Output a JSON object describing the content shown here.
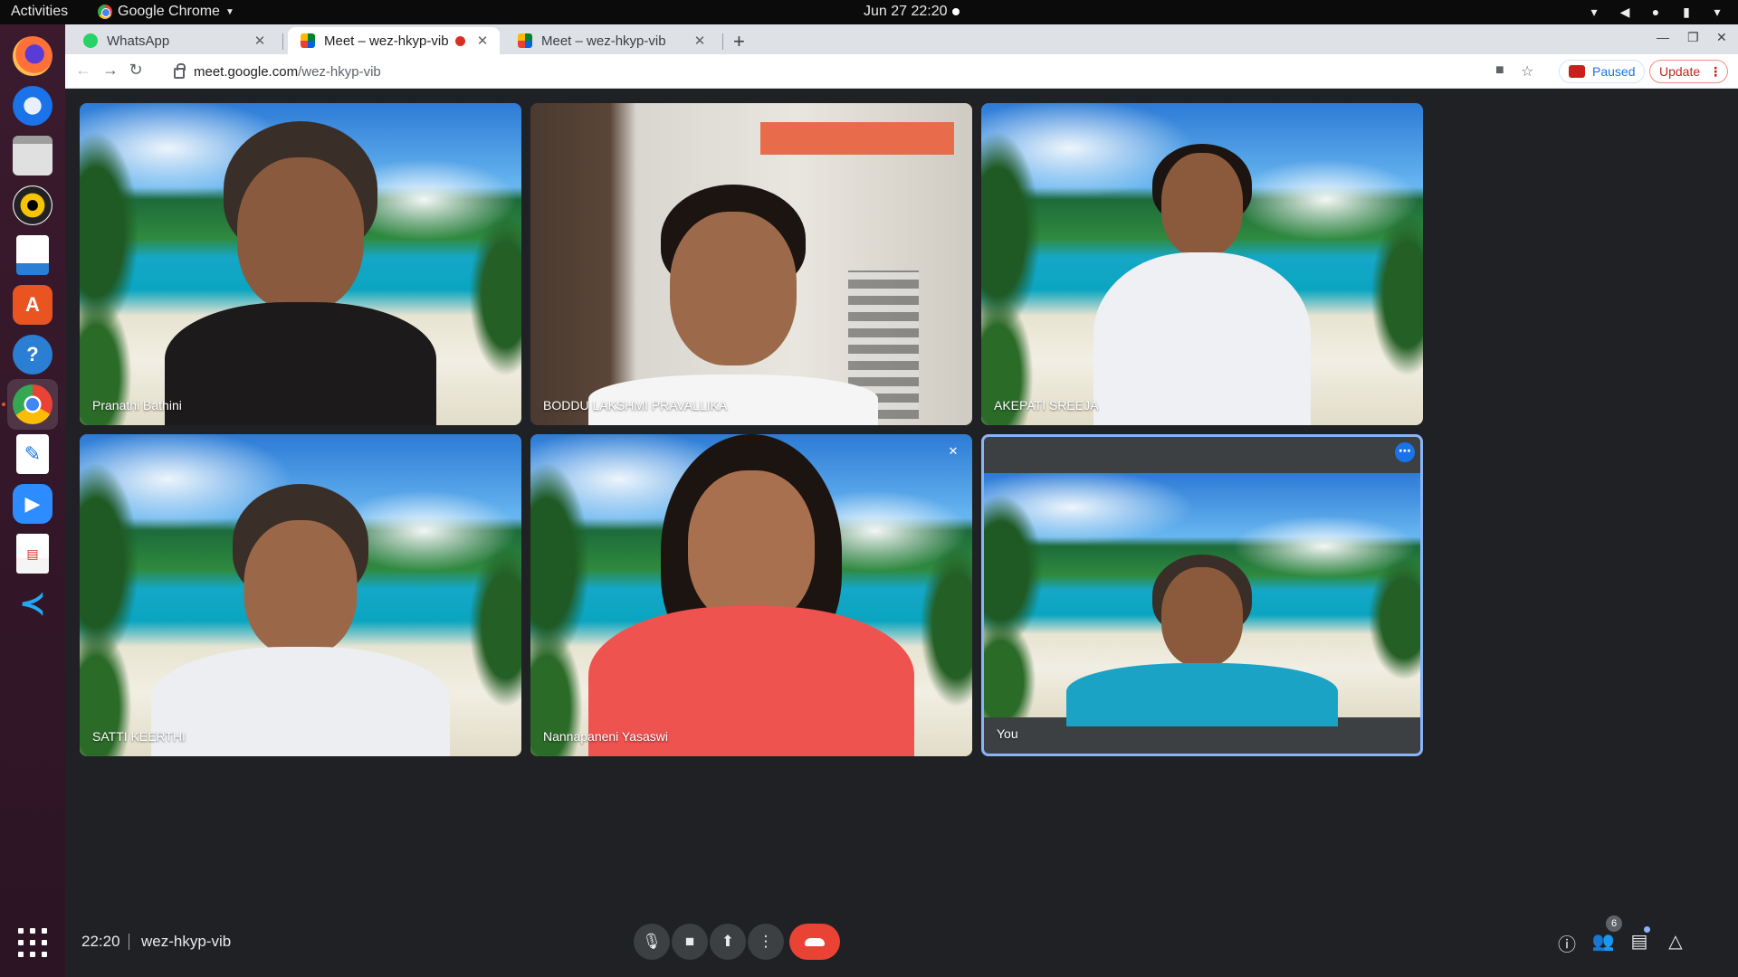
{
  "topbar": {
    "activities": "Activities",
    "app_name": "Google Chrome",
    "datetime": "Jun 27  22:20"
  },
  "dock": {
    "apps": [
      "firefox-icon",
      "thunderbird-icon",
      "files-icon",
      "rhythmbox-icon",
      "libreoffice-writer-icon",
      "software-center-icon",
      "help-icon",
      "chrome-icon",
      "text-editor-icon",
      "zoom-icon",
      "document-viewer-icon",
      "vscode-icon"
    ]
  },
  "browser": {
    "tabs": [
      {
        "title": "WhatsApp"
      },
      {
        "title": "Meet – wez-hkyp-vib"
      },
      {
        "title": "Meet – wez-hkyp-vib"
      }
    ],
    "url_host": "meet.google.com",
    "url_path": "/wez-hkyp-vib",
    "paused_label": "Paused",
    "update_label": "Update"
  },
  "meet": {
    "participants": [
      {
        "name": "Pranathi Bathini",
        "muted": false
      },
      {
        "name": "BODDU LAKSHMI PRAVALLIKA",
        "muted": false
      },
      {
        "name": "AKEPATI SREEJA",
        "muted": false
      },
      {
        "name": "SATTI KEERTHI",
        "muted": false
      },
      {
        "name": "Nannapaneni Yasaswi",
        "muted": true
      },
      {
        "name": "You",
        "muted": false
      }
    ],
    "time": "22:20",
    "meeting_code": "wez-hkyp-vib",
    "people_count": "6"
  },
  "colors": {
    "meet_bg": "#202124",
    "leave_red": "#ea4335",
    "self_border": "#8ab4f8",
    "dock_bg": "#3b1a2e"
  }
}
